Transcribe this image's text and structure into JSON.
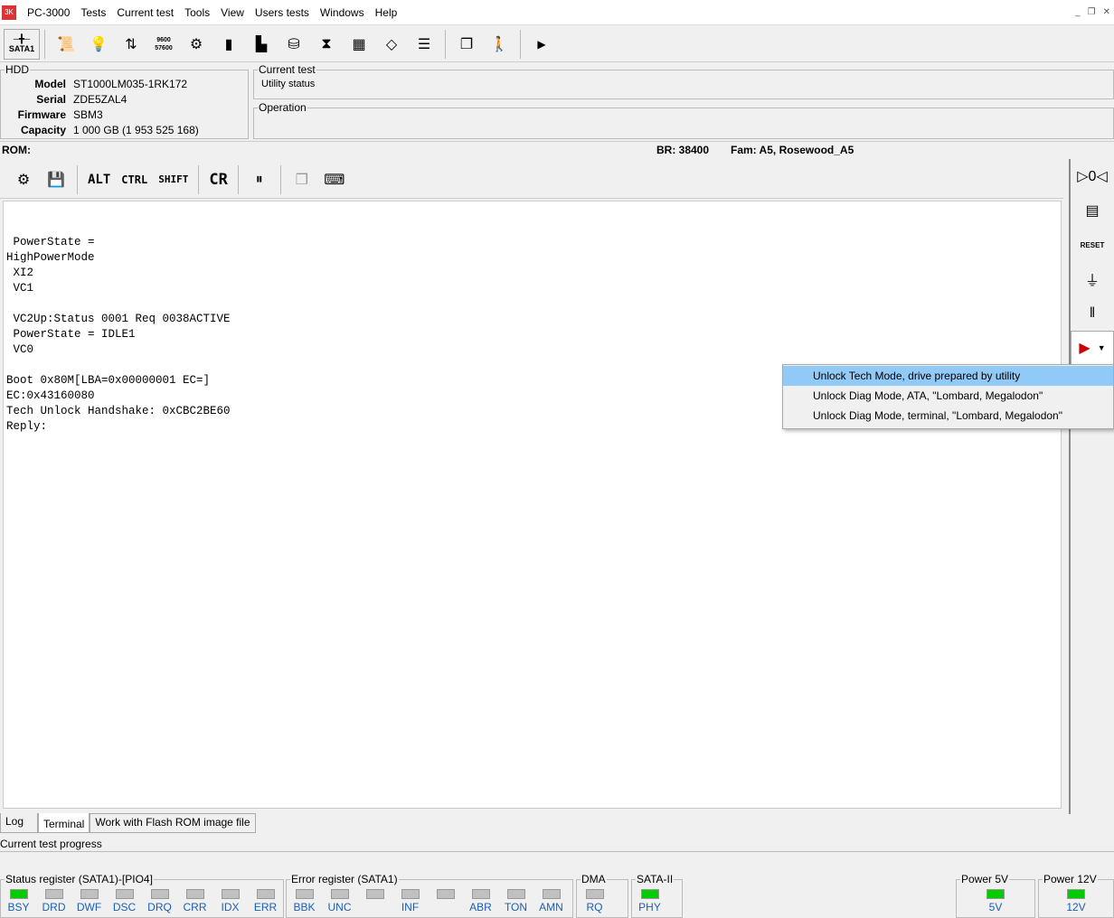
{
  "app": {
    "title": "PC-3000",
    "menu": [
      "Tests",
      "Current test",
      "Tools",
      "View",
      "Users tests",
      "Windows",
      "Help"
    ]
  },
  "toolbar": {
    "port": "SATA1",
    "baud_icon": "9600 57600"
  },
  "hdd": {
    "legend": "HDD",
    "fields": [
      {
        "k": "Model",
        "v": "ST1000LM035-1RK172"
      },
      {
        "k": "Serial",
        "v": "ZDE5ZAL4"
      },
      {
        "k": "Firmware",
        "v": "SBM3"
      },
      {
        "k": "Capacity",
        "v": "1 000 GB (1 953 525 168)"
      }
    ]
  },
  "current_test": {
    "legend": "Current test",
    "status": "Utility status"
  },
  "operation": {
    "legend": "Operation"
  },
  "rom": {
    "label": "ROM:",
    "br": "BR: 38400",
    "fam": "Fam: A5, Rosewood_A5"
  },
  "term_toolbar": {
    "alt": "ALT",
    "ctrl": "CTRL",
    "shift": "SHIFT",
    "cr": "CR"
  },
  "terminal": {
    "text": "\n PowerState =\nHighPowerMode\n XI2\n VC1\n\n VC2Up:Status 0001 Req 0038ACTIVE\n PowerState = IDLE1\n VC0\n\nBoot 0x80M[LBA=0x00000001 EC=]\nEC:0x43160080\nTech Unlock Handshake: 0xCBC2BE60\nReply:"
  },
  "dropdown": [
    "Unlock Tech Mode, drive prepared by utility",
    "Unlock Diag Mode, ATA, \"Lombard, Megalodon\"",
    "Unlock Diag Mode, terminal, \"Lombard, Megalodon\""
  ],
  "tabs": [
    "Log",
    "Terminal",
    "Work with Flash ROM image file"
  ],
  "progress_label": "Current test progress",
  "status_register": {
    "legend": "Status register (SATA1)-[PIO4]",
    "bits": [
      {
        "l": "BSY",
        "on": true
      },
      {
        "l": "DRD",
        "on": false
      },
      {
        "l": "DWF",
        "on": false
      },
      {
        "l": "DSC",
        "on": false
      },
      {
        "l": "DRQ",
        "on": false
      },
      {
        "l": "CRR",
        "on": false
      },
      {
        "l": "IDX",
        "on": false
      },
      {
        "l": "ERR",
        "on": false
      }
    ]
  },
  "error_register": {
    "legend": "Error register (SATA1)",
    "bits": [
      {
        "l": "BBK",
        "on": false
      },
      {
        "l": "UNC",
        "on": false
      },
      {
        "l": "",
        "on": false
      },
      {
        "l": "INF",
        "on": false
      },
      {
        "l": "",
        "on": false
      },
      {
        "l": "ABR",
        "on": false
      },
      {
        "l": "TON",
        "on": false
      },
      {
        "l": "AMN",
        "on": false
      }
    ]
  },
  "dma": {
    "legend": "DMA",
    "bits": [
      {
        "l": "RQ",
        "on": false
      }
    ]
  },
  "sata2": {
    "legend": "SATA-II",
    "bits": [
      {
        "l": "PHY",
        "on": true
      }
    ]
  },
  "power5": {
    "legend": "Power 5V",
    "bits": [
      {
        "l": "5V",
        "on": true
      }
    ]
  },
  "power12": {
    "legend": "Power 12V",
    "bits": [
      {
        "l": "12V",
        "on": true
      }
    ]
  }
}
